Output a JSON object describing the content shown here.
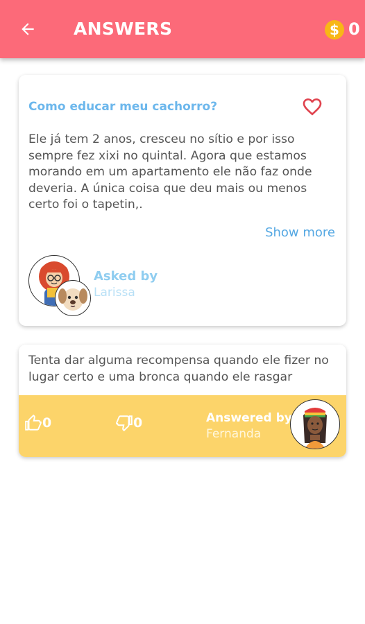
{
  "header": {
    "title": "ANSWERS",
    "back_icon": "arrow-left-icon",
    "coin_icon": "coin-icon",
    "coin_symbol": "$",
    "coins": "0"
  },
  "question": {
    "title": "Como educar meu cachorro?",
    "body": "Ele já tem 2 anos, cresceu no sítio e por isso sempre fez xixi no quintal. Agora que estamos morando em um apartamento ele não faz onde deveria. A única coisa que deu mais ou menos certo foi o tapetin,.",
    "show_more": "Show more",
    "asked_by_label": "Asked by",
    "asker_name": "Larissa",
    "favorite_icon": "heart-outline-icon"
  },
  "answer": {
    "body": "Tenta dar alguma recompensa quando ele fizer no lugar certo e uma bronca quando ele rasgar",
    "likes": "0",
    "dislikes": "0",
    "answered_by_label": "Answered by",
    "answerer_name": "Fernanda"
  },
  "colors": {
    "header": "#fc6a79",
    "question_title": "#6cb7ec",
    "answer_bar": "#fcd46a",
    "coin": "#f8b716",
    "heart": "#e0434e"
  }
}
